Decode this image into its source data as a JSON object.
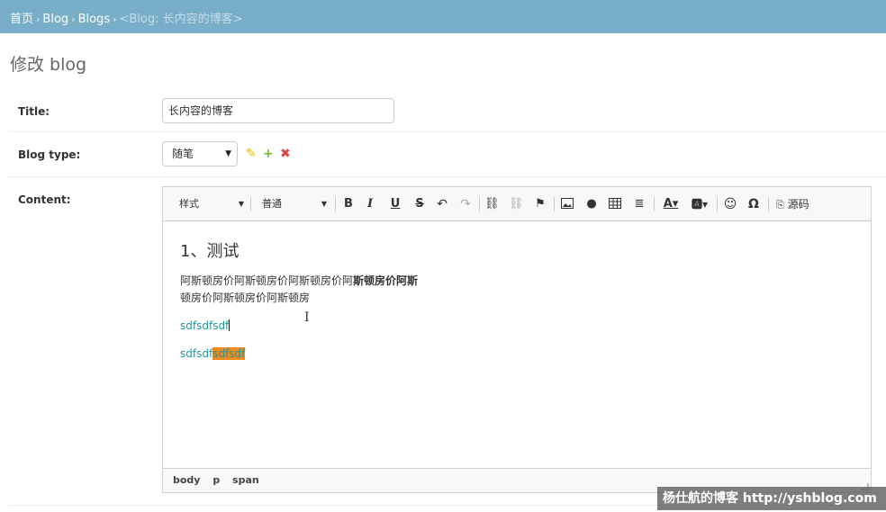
{
  "breadcrumbs": {
    "home": "首页",
    "app": "Blog",
    "model": "Blogs",
    "current": "<Blog: 长内容的博客>",
    "separator": "›"
  },
  "page_title": "修改 blog",
  "fields": {
    "title": {
      "label": "Title:",
      "value": "长内容的博客"
    },
    "blog_type": {
      "label": "Blog type:",
      "value": "随笔"
    },
    "content": {
      "label": "Content:"
    }
  },
  "related_icons": [
    "pencil-icon",
    "plus-icon",
    "delete-icon"
  ],
  "toolbar": {
    "styles_combo": "样式",
    "format_combo": "普通",
    "bold": "B",
    "italic": "I",
    "underline": "U",
    "strike": "S",
    "source": "源码"
  },
  "editor_content": {
    "heading": "1、测试",
    "para_normal": "阿斯顿房价阿斯顿房价阿斯顿房价阿",
    "para_bold": "斯顿房价阿斯",
    "para_line2": "顿房价阿斯顿房价阿斯顿房",
    "line3": "sdfsdfsdf",
    "line4_plain": "sdfsdf",
    "line4_highlight": "sdfsdf"
  },
  "element_path": [
    "body",
    "p",
    "span"
  ],
  "colors": {
    "header_bg": "#79aec8",
    "link_teal": "#1a9a9f",
    "highlight": "#f08a1e",
    "edit_yellow": "#efb80b",
    "add_green": "#70bf2b",
    "delete_red": "#dd4646"
  },
  "watermark": "杨仕航的博客 http://yshblog.com"
}
